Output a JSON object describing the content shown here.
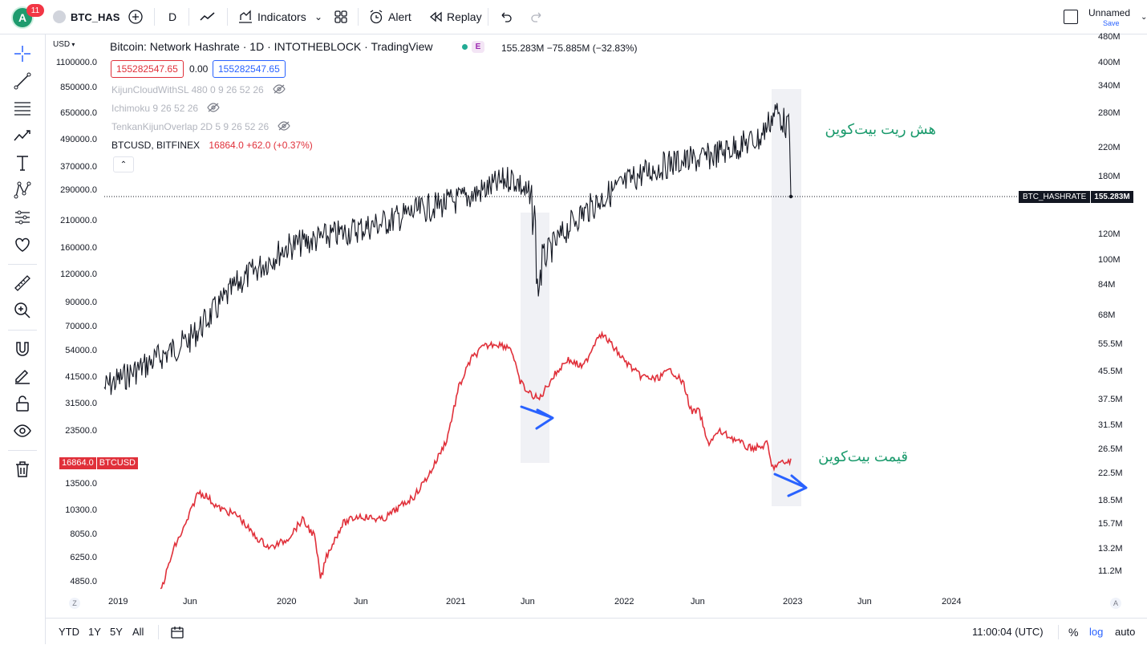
{
  "topbar": {
    "avatar_letter": "A",
    "notification_count": "11",
    "symbol": "BTC_HAS",
    "interval": "D",
    "indicators_label": "Indicators",
    "alert_label": "Alert",
    "replay_label": "Replay",
    "layout_name": "Unnamed",
    "save_label": "Save"
  },
  "left_axis": {
    "currency": "USD",
    "labels": [
      "1100000.0",
      "850000.0",
      "650000.0",
      "490000.0",
      "370000.0",
      "290000.0",
      "210000.0",
      "160000.0",
      "120000.0",
      "90000.0",
      "70000.0",
      "54000.0",
      "41500.0",
      "31500.0",
      "23500.0",
      "13500.0",
      "10300.0",
      "8050.0",
      "6250.0",
      "4850.0"
    ],
    "price_tag": "16864.0",
    "price_tag_symbol": "BTCUSD",
    "scale_mode": "Z"
  },
  "right_axis": {
    "labels": [
      "480M",
      "400M",
      "340M",
      "280M",
      "220M",
      "180M",
      "120M",
      "100M",
      "84M",
      "68M",
      "55.5M",
      "45.5M",
      "37.5M",
      "31.5M",
      "26.5M",
      "22.5M",
      "18.5M",
      "15.7M",
      "13.2M",
      "11.2M"
    ],
    "price_tag_symbol": "BTC_HASHRATE",
    "price_tag": "155.283M",
    "scale_mode": "A"
  },
  "x_axis": {
    "labels": [
      "2019",
      "Jun",
      "2020",
      "Jun",
      "2021",
      "Jun",
      "2022",
      "Jun",
      "2023",
      "Jun",
      "2024"
    ]
  },
  "legend": {
    "title": "Bitcoin: Network Hashrate · 1D · INTOTHEBLOCK · TradingView",
    "badge": "E",
    "values": "155.283M −75.885M (−32.83%)",
    "box1": "155282547.65",
    "box_mid": "0.00",
    "box2": "155282547.65",
    "indicators": [
      "KijunCloudWithSL 480 0 9 26 52 26",
      "Ichimoku 9 26 52 26",
      "TenkanKijunOverlap 2D 5 9 26 52 26"
    ],
    "btc_symbol": "BTCUSD, BITFINEX",
    "btc_values": "16864.0 +62.0 (+0.37%)"
  },
  "annotations": {
    "hashrate_label": "هش ریت بیت‌کوین",
    "price_label": "قیمت بیت‌کوین"
  },
  "bottom_bar": {
    "ranges": [
      "YTD",
      "1Y",
      "5Y",
      "All"
    ],
    "time": "11:00:04 (UTC)",
    "percent": "%",
    "log": "log",
    "auto": "auto"
  },
  "colors": {
    "hashrate_line": "#131722",
    "price_line": "#e0303a",
    "annotation_text": "#1a9a6c",
    "arrow": "#2962ff",
    "accent": "#2962ff",
    "notification": "#f23645"
  }
}
